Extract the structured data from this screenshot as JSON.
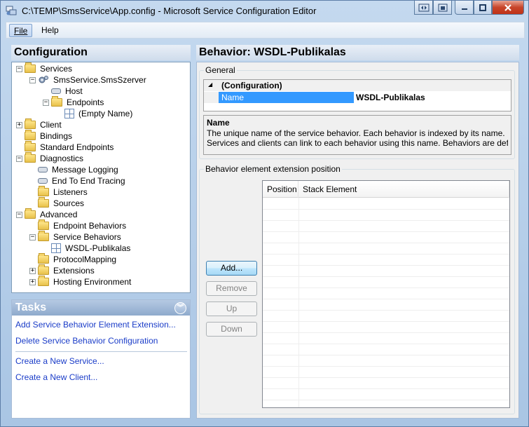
{
  "window": {
    "title": "C:\\TEMP\\SmsService\\App.config - Microsoft Service Configuration Editor",
    "icons": [
      "app-icon",
      "system-icon",
      "minimize-icon",
      "maximize-icon",
      "close-icon"
    ]
  },
  "menu": {
    "file": "File",
    "help": "Help"
  },
  "left": {
    "header": "Configuration",
    "tree": [
      {
        "label": "Services",
        "exp": "−",
        "icon": "folder"
      },
      {
        "label": "SmsService.SmsSzerver",
        "exp": "−",
        "icon": "gear"
      },
      {
        "label": "Host",
        "exp": "",
        "icon": "small"
      },
      {
        "label": "Endpoints",
        "exp": "−",
        "icon": "folder"
      },
      {
        "label": "(Empty Name)",
        "exp": "",
        "icon": "grid"
      },
      {
        "label": "Client",
        "exp": "+",
        "icon": "folder"
      },
      {
        "label": "Bindings",
        "exp": "",
        "icon": "folder"
      },
      {
        "label": "Standard Endpoints",
        "exp": "",
        "icon": "folder"
      },
      {
        "label": "Diagnostics",
        "exp": "−",
        "icon": "folder"
      },
      {
        "label": "Message Logging",
        "exp": "",
        "icon": "small"
      },
      {
        "label": "End To End Tracing",
        "exp": "",
        "icon": "small"
      },
      {
        "label": "Listeners",
        "exp": "",
        "icon": "folder"
      },
      {
        "label": "Sources",
        "exp": "",
        "icon": "folder"
      },
      {
        "label": "Advanced",
        "exp": "−",
        "icon": "folder"
      },
      {
        "label": "Endpoint Behaviors",
        "exp": "",
        "icon": "folder"
      },
      {
        "label": "Service Behaviors",
        "exp": "−",
        "icon": "folder"
      },
      {
        "label": "WSDL-Publikalas",
        "exp": "",
        "icon": "grid"
      },
      {
        "label": "ProtocolMapping",
        "exp": "",
        "icon": "folder"
      },
      {
        "label": "Extensions",
        "exp": "+",
        "icon": "folder"
      },
      {
        "label": "Hosting Environment",
        "exp": "+",
        "icon": "folder"
      }
    ],
    "tasks": {
      "header": "Tasks",
      "links": [
        "Add Service Behavior Element Extension...",
        "Delete Service Behavior Configuration",
        "Create a New Service...",
        "Create a New Client..."
      ]
    }
  },
  "right": {
    "header": "Behavior: WSDL-Publikalas",
    "general": {
      "title": "General",
      "category": "(Configuration)",
      "prop_name": "Name",
      "prop_value": "WSDL-Publikalas",
      "desc_title": "Name",
      "desc_line1": "The unique name of the service behavior. Each behavior is indexed by its name.",
      "desc_line2": "Services and clients can link to each behavior using this name. Behaviors are define..."
    },
    "extension": {
      "title": "Behavior element extension position",
      "buttons": {
        "add": "Add...",
        "remove": "Remove",
        "up": "Up",
        "down": "Down"
      },
      "columns": [
        "Position",
        "Stack Element"
      ]
    }
  }
}
